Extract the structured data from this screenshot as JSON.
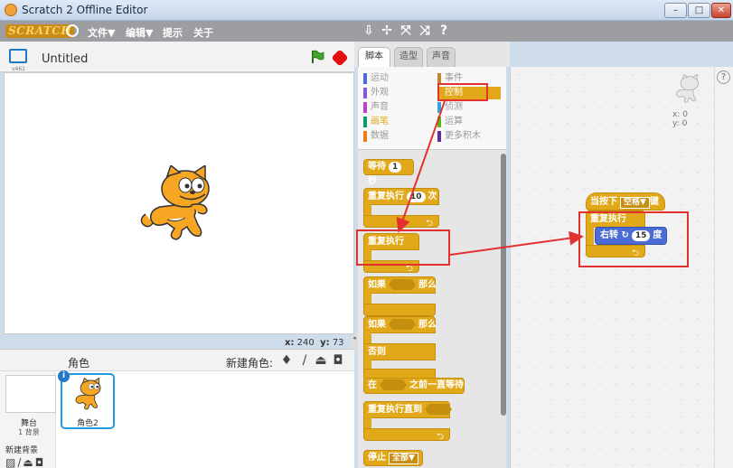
{
  "window": {
    "title": "Scratch 2 Offline Editor",
    "min": "–",
    "max": "□",
    "close": "✕"
  },
  "menubar": {
    "logo": "SCRATCH",
    "file": "文件▼",
    "edit": "编辑▼",
    "tips": "提示",
    "about": "关于"
  },
  "stage": {
    "project_title": "Untitled",
    "version": "v461",
    "coords_x_label": "x:",
    "coords_x": "240",
    "coords_y_label": "y:",
    "coords_y": "73"
  },
  "sprites": {
    "label": "角色",
    "new_sprite_label": "新建角色:",
    "stage_label": "舞台",
    "backdrop_count": "1 背景",
    "new_backdrop_label": "新建背景",
    "sprite_name": "角色2"
  },
  "tabs": [
    "脚本",
    "造型",
    "声音"
  ],
  "categories": [
    {
      "label": "运动",
      "color": "#4a6cd4"
    },
    {
      "label": "事件",
      "color": "#c88330"
    },
    {
      "label": "外观",
      "color": "#8a55d7"
    },
    {
      "label": "控制",
      "color": "#e1a91a"
    },
    {
      "label": "声音",
      "color": "#bb42c3"
    },
    {
      "label": "侦测",
      "color": "#2ca5e2"
    },
    {
      "label": "画笔",
      "color": "#0e9a6c"
    },
    {
      "label": "运算",
      "color": "#5cb712"
    },
    {
      "label": "数据",
      "color": "#ee7d16"
    },
    {
      "label": "更多积木",
      "color": "#632d99"
    }
  ],
  "palette": {
    "wait": "等待",
    "wait_value": "1",
    "wait_unit": "秒",
    "repeat": "重复执行",
    "repeat_value": "10",
    "repeat_unit": "次",
    "forever": "重复执行",
    "if_label": "如果",
    "then_label": "那么",
    "else_label": "否则",
    "wait_until_prefix": "在",
    "wait_until_suffix": "之前一直等待",
    "repeat_until": "重复执行直到",
    "stop": "停止",
    "stop_option": "全部▼"
  },
  "script": {
    "hat_prefix": "当按下",
    "hat_key": "空格▼",
    "hat_suffix": "键",
    "forever": "重复执行",
    "turn_label": "右转",
    "turn_value": "15",
    "turn_unit": "度",
    "x_readout": "x: 0",
    "y_readout": "y: 0"
  },
  "colors": {
    "control": "#e1a91a",
    "motion": "#4a6cd4",
    "annotation": "#e53030",
    "menubar": "#9c9ea2"
  }
}
